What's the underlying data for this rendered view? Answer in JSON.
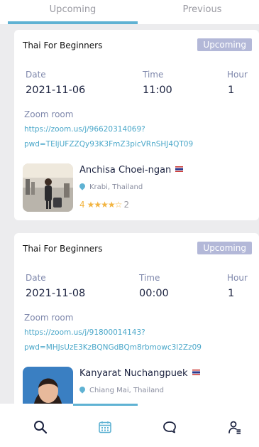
{
  "tabs": {
    "upcoming": "Upcoming",
    "previous": "Previous"
  },
  "lessons": [
    {
      "course": "Thai For Beginners",
      "status": "Upcoming",
      "date_label": "Date",
      "date": "2021-11-06",
      "time_label": "Time",
      "time": "11:00",
      "hour_label": "Hour",
      "hour": "1",
      "zoom_label": "Zoom room",
      "zoom_link_1": "https://zoom.us/j/96620314069?",
      "zoom_link_2": "pwd=TEljUFZZQy93K3FmZ3picVRnSHJ4QT09",
      "teacher": "Anchisa Choei-ngan",
      "location": "Krabi, Thailand",
      "rating": "4",
      "stars": "★★★★☆",
      "reviews": "2"
    },
    {
      "course": "Thai For Beginners",
      "status": "Upcoming",
      "date_label": "Date",
      "date": "2021-11-08",
      "time_label": "Time",
      "time": "00:00",
      "hour_label": "Hour",
      "hour": "1",
      "zoom_label": "Zoom room",
      "zoom_link_1": "https://zoom.us/j/91800014143?",
      "zoom_link_2": "pwd=MHJsUzE3KzBQNGdBQm8rbmowc3l2Zz09",
      "teacher": "Kanyarat Nuchangpuek",
      "location": "Chiang Mai, Thailand"
    }
  ],
  "nav": [
    "search-icon",
    "calendar-icon",
    "chat-icon",
    "profile-list-icon"
  ],
  "colors": {
    "accent": "#5fb2d3",
    "badge": "#b3b8d8",
    "star": "#f2b441"
  }
}
